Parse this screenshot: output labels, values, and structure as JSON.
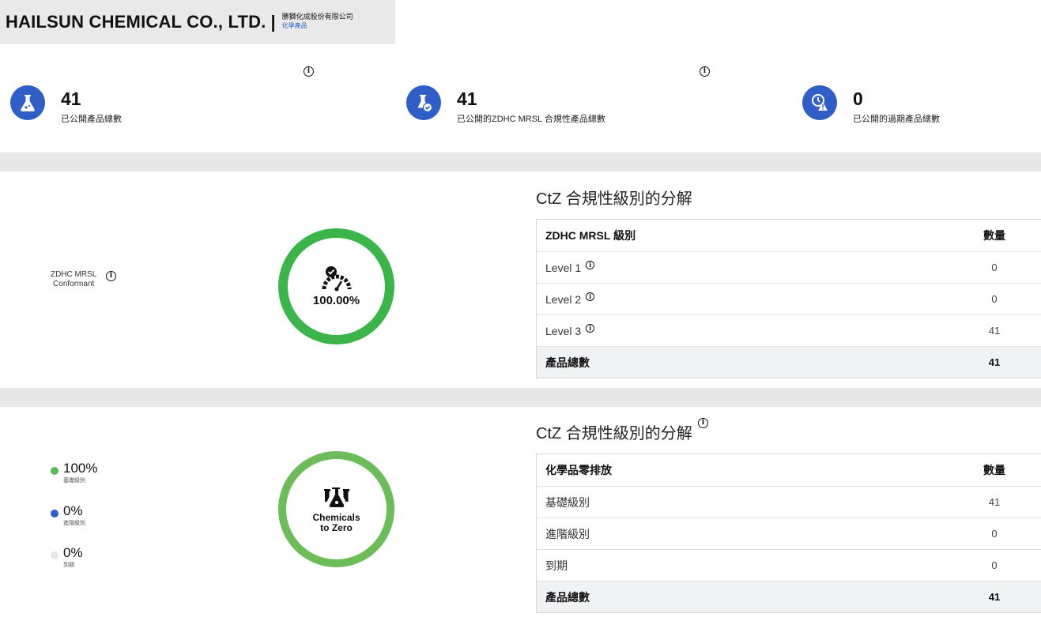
{
  "header": {
    "company": "HAILSUN CHEMICAL CO., LTD.",
    "separator": "|",
    "company_local": "勝獅化成股份有限公司",
    "category_link": "化學產品"
  },
  "stats": [
    {
      "value": "41",
      "label": "已公開產品總數",
      "icon": "flask-icon"
    },
    {
      "value": "41",
      "label": "已公開的ZDHC MRSL 合規性產品總數",
      "icon": "flask-check-icon"
    },
    {
      "value": "0",
      "label": "已公開的過期產品總數",
      "icon": "alert-clock-icon"
    }
  ],
  "conformance": {
    "label_line1": "ZDHC MRSL",
    "label_line2": "Conformant",
    "percent": "100.00%",
    "ring_color": "#3bb54a"
  },
  "table1": {
    "title": "CtZ 合規性級別的分解",
    "col_level": "ZDHC MRSL 級別",
    "col_count": "數量",
    "rows": [
      {
        "label": "Level 1",
        "count": "0"
      },
      {
        "label": "Level 2",
        "count": "0"
      },
      {
        "label": "Level 3",
        "count": "41"
      }
    ],
    "total_label": "產品總數",
    "total_count": "41"
  },
  "ctz": {
    "ring_text_line1": "Chemicals",
    "ring_text_line2": "to Zero",
    "ring_color": "#6cbd5a",
    "legend": [
      {
        "value": "100%",
        "sub": "基礎級別",
        "color": "#5cb85c"
      },
      {
        "value": "0%",
        "sub": "進階級別",
        "color": "#2f5fc6"
      },
      {
        "value": "0%",
        "sub": "到期",
        "color": "#e6e6e6"
      }
    ]
  },
  "table2": {
    "title": "CtZ 合規性級別的分解",
    "col_level": "化學品零排放",
    "col_count": "數量",
    "rows": [
      {
        "label": "基礎級別",
        "count": "41"
      },
      {
        "label": "進階級別",
        "count": "0"
      },
      {
        "label": "到期",
        "count": "0"
      }
    ],
    "total_label": "產品總數",
    "total_count": "41"
  }
}
